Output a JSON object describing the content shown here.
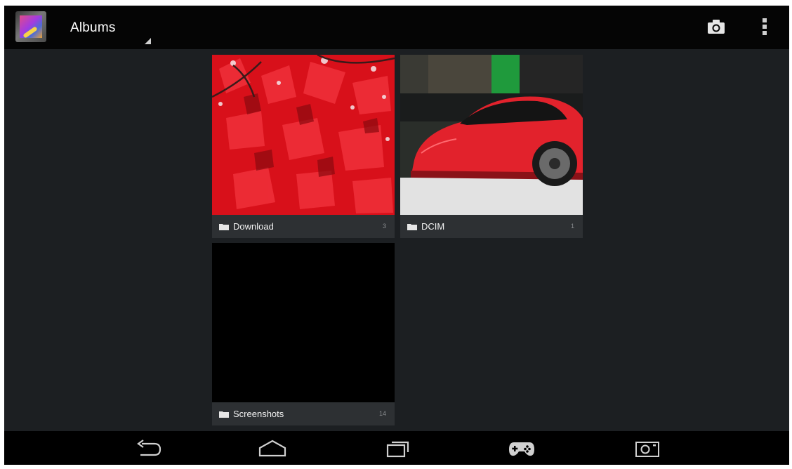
{
  "action_bar": {
    "title": "Albums",
    "app_icon": "gallery-app-icon",
    "actions": [
      {
        "name": "camera-icon"
      },
      {
        "name": "overflow-menu-icon"
      }
    ]
  },
  "albums": [
    {
      "name": "Download",
      "count": "3",
      "thumbnail": "red-autumn-leaves"
    },
    {
      "name": "DCIM",
      "count": "1",
      "thumbnail": "red-sports-car"
    },
    {
      "name": "Screenshots",
      "count": "14",
      "thumbnail": "black-screenshot"
    }
  ],
  "nav_bar": {
    "buttons": [
      "back-icon",
      "home-icon",
      "recent-apps-icon",
      "game-controller-icon",
      "screenshot-icon"
    ]
  },
  "colors": {
    "background": "#1c1f22",
    "action_bar": "#050505",
    "label_bar": "#2d3033",
    "accent_red": "#e0202a"
  }
}
